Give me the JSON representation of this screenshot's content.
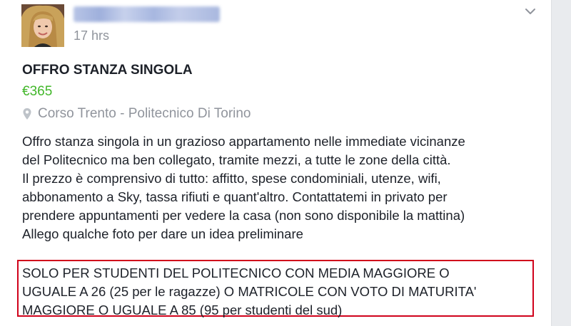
{
  "post": {
    "timestamp": "17 hrs",
    "title": "OFFRO STANZA SINGOLA",
    "price": "€365",
    "location": "Corso Trento - Politecnico Di Torino",
    "description_lines": [
      "Offro stanza singola in un grazioso appartamento nelle immediate vicinanze",
      "del Politecnico ma ben collegato, tramite mezzi, a tutte le zone della città.",
      "Il prezzo è comprensivo di tutto: affitto, spese condominiali, utenze, wifi,",
      "abbonamento a Sky, tassa rifiuti e quant'altro. Contattatemi in privato per",
      "prendere appuntamenti per vedere la casa (non sono disponibile la mattina)",
      "Allego qualche foto per dare un idea preliminare"
    ],
    "highlighted_lines": [
      "SOLO PER STUDENTI DEL POLITECNICO CON MEDIA MAGGIORE O",
      "UGUALE A 26 (25 per le ragazze) O MATRICOLE CON VOTO DI MATURITA'",
      "MAGGIORE O UGUALE A 85 (95 per studenti del sud)"
    ]
  },
  "icons": {
    "avatar": "profile-photo",
    "menu": "chevron-down-icon",
    "location": "map-pin-icon"
  },
  "colors": {
    "price": "#42b72a",
    "muted": "#90949c",
    "highlight_border": "#d0021b"
  }
}
